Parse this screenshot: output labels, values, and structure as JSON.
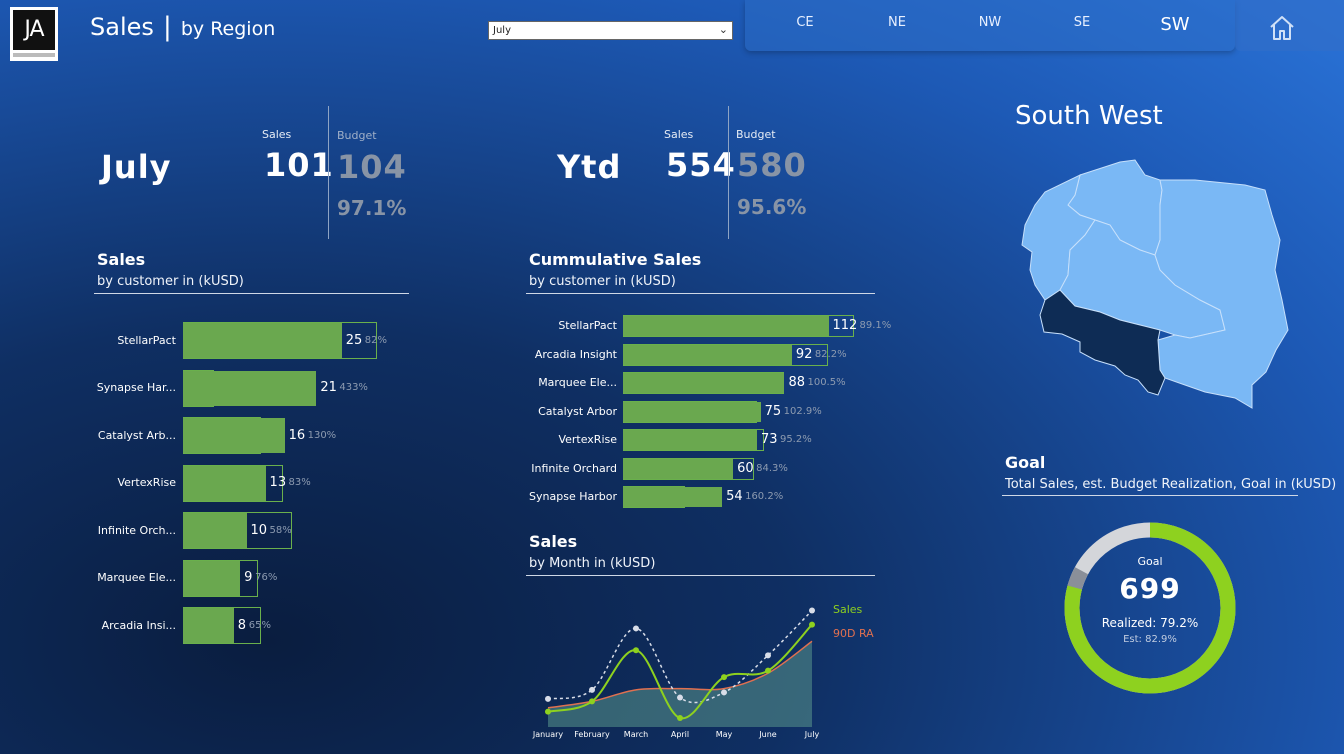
{
  "header": {
    "logo_text": "JA",
    "title_main": "Sales",
    "title_sep": "|",
    "title_sub": "by Region",
    "month_select_value": "July",
    "regions": [
      "CE",
      "NE",
      "NW",
      "SE",
      "SW"
    ],
    "active_region": "SW",
    "home_icon": "home-icon"
  },
  "kpi": {
    "month": {
      "label": "July",
      "sales_label": "Sales",
      "budget_label": "Budget",
      "sales": "101",
      "budget": "104",
      "pct": "97.1%"
    },
    "ytd": {
      "label": "Ytd",
      "sales_label": "Sales",
      "budget_label": "Budget",
      "sales": "554",
      "budget": "580",
      "pct": "95.6%"
    }
  },
  "sales_by_customer": {
    "title": "Sales",
    "subtitle": "by customer in (kUSD)",
    "rows": [
      {
        "name": "StellarPact",
        "value": 25,
        "value_label": "25",
        "pct": "82%",
        "budget": 30.5
      },
      {
        "name": "Synapse Har...",
        "value": 21,
        "value_label": "21",
        "pct": "433%",
        "budget": 4.85
      },
      {
        "name": "Catalyst Arb...",
        "value": 16,
        "value_label": "16",
        "pct": "130%",
        "budget": 12.3
      },
      {
        "name": "VertexRise",
        "value": 13,
        "value_label": "13",
        "pct": "83%",
        "budget": 15.7
      },
      {
        "name": "Infinite Orch...",
        "value": 10,
        "value_label": "10",
        "pct": "58%",
        "budget": 17.2
      },
      {
        "name": "Marquee Ele...",
        "value": 9,
        "value_label": "9",
        "pct": "76%",
        "budget": 11.8
      },
      {
        "name": "Arcadia Insi...",
        "value": 8,
        "value_label": "8",
        "pct": "65%",
        "budget": 12.3
      }
    ]
  },
  "cumulative_sales": {
    "title": "Cummulative Sales",
    "subtitle": "by customer in (kUSD)",
    "rows": [
      {
        "name": "StellarPact",
        "value": 112,
        "value_label": "112",
        "pct": "89.1%",
        "budget": 125.7
      },
      {
        "name": "Arcadia Insight",
        "value": 92,
        "value_label": "92",
        "pct": "82.2%",
        "budget": 111.9
      },
      {
        "name": "Marquee Ele...",
        "value": 88,
        "value_label": "88",
        "pct": "100.5%",
        "budget": 87.6
      },
      {
        "name": "Catalyst Arbor",
        "value": 75,
        "value_label": "75",
        "pct": "102.9%",
        "budget": 72.9
      },
      {
        "name": "VertexRise",
        "value": 73,
        "value_label": "73",
        "pct": "95.2%",
        "budget": 76.7
      },
      {
        "name": "Infinite Orchard",
        "value": 60,
        "value_label": "60",
        "pct": "84.3%",
        "budget": 71.2
      },
      {
        "name": "Synapse Harbor",
        "value": 54,
        "value_label": "54",
        "pct": "160.2%",
        "budget": 33.7
      }
    ]
  },
  "map": {
    "title": "South West"
  },
  "sales_by_month": {
    "title": "Sales",
    "subtitle": "by Month in (kUSD)",
    "legend_sales": "Sales",
    "legend_ra": "90D RA",
    "months": [
      "January",
      "February",
      "March",
      "April",
      "May",
      "June",
      "July"
    ]
  },
  "chart_data": {
    "type": "line",
    "x": [
      "January",
      "February",
      "March",
      "April",
      "May",
      "June",
      "July"
    ],
    "series": [
      {
        "name": "Sales",
        "values": [
          62,
          70,
          110,
          57,
          89,
          94,
          130
        ]
      },
      {
        "name": "90D RA",
        "values": [
          65,
          70,
          79,
          80,
          80,
          92,
          117
        ]
      },
      {
        "name": "",
        "values": [
          72,
          79,
          127,
          73,
          77,
          106,
          141
        ]
      }
    ],
    "ylim": [
      50,
      150
    ],
    "colors": {
      "Sales": "#8ed11f",
      "90D RA": "#e07050",
      "budget": "#d8dde8"
    }
  },
  "goal": {
    "title": "Goal",
    "subtitle": "Total Sales, est. Budget Realization, Goal in (kUSD)",
    "goal_label": "Goal",
    "goal_value": "699",
    "realized_label": "Realized:",
    "realized_value": "79.2%",
    "est_label": "Est:",
    "est_value": "82.9%",
    "realized_fraction": 0.792,
    "est_fraction": 0.829,
    "colors": {
      "realized": "#8ed11f",
      "est": "#8a8f99",
      "remaining": "#d4d6da"
    }
  }
}
